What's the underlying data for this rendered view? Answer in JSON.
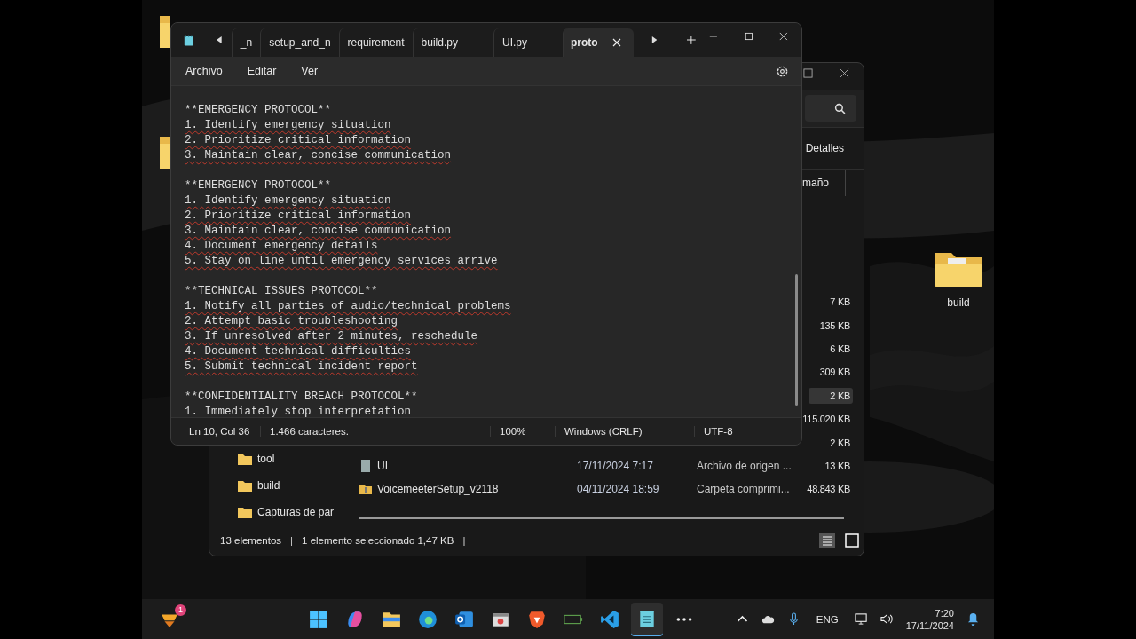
{
  "notepad": {
    "tabs": [
      {
        "label": "_n",
        "selected": false
      },
      {
        "label": "setup_and_n",
        "selected": false
      },
      {
        "label": "requirement",
        "selected": false
      },
      {
        "label": "build.py",
        "selected": false
      },
      {
        "label": "UI.py",
        "selected": false
      },
      {
        "label": "proto",
        "selected": true
      }
    ],
    "menu": [
      "Archivo",
      "Editar",
      "Ver"
    ],
    "lines": [
      {
        "kind": "header",
        "text": "**EMERGENCY PROTOCOL**"
      },
      {
        "kind": "item",
        "text": "1. Identify emergency situation"
      },
      {
        "kind": "item",
        "text": "2. Prioritize critical information"
      },
      {
        "kind": "item",
        "text": "3. Maintain clear, concise communication"
      },
      {
        "kind": "blank"
      },
      {
        "kind": "header",
        "text": "**EMERGENCY PROTOCOL**"
      },
      {
        "kind": "item",
        "text": "1. Identify emergency situation"
      },
      {
        "kind": "item",
        "text": "2. Prioritize critical information"
      },
      {
        "kind": "item",
        "text": "3. Maintain clear, concise communication"
      },
      {
        "kind": "item",
        "text": "4. Document emergency details"
      },
      {
        "kind": "item",
        "text": "5. Stay on line until emergency services arrive"
      },
      {
        "kind": "blank"
      },
      {
        "kind": "header",
        "text": "**TECHNICAL ISSUES PROTOCOL**"
      },
      {
        "kind": "item",
        "text": "1. Notify all parties of audio/technical problems"
      },
      {
        "kind": "item",
        "text": "2. Attempt basic troubleshooting"
      },
      {
        "kind": "item",
        "text": "3. If unresolved after 2 minutes, reschedule"
      },
      {
        "kind": "item",
        "text": "4. Document technical difficulties"
      },
      {
        "kind": "item",
        "text": "5. Submit technical incident report"
      },
      {
        "kind": "blank"
      },
      {
        "kind": "header",
        "text": "**CONFIDENTIALITY BREACH PROTOCOL**"
      },
      {
        "kind": "item",
        "text": "1. Immediately stop interpretation"
      }
    ],
    "status": {
      "position": "Ln 10, Col 36",
      "chars": "1.466 caracteres.",
      "zoom": "100%",
      "line_ending": "Windows (CRLF)",
      "encoding": "UTF-8"
    }
  },
  "explorer": {
    "view_button": "Detalles",
    "size_header": "maño",
    "nav": [
      "tool",
      "build",
      "Capturas de par"
    ],
    "files": [
      {
        "size": "7 KB",
        "selected": false
      },
      {
        "size": "135 KB",
        "selected": false
      },
      {
        "size": "6 KB",
        "selected": false
      },
      {
        "size": "309 KB",
        "selected": false
      },
      {
        "size": "2 KB",
        "selected": true
      },
      {
        "size": "115.020 KB",
        "selected": false
      },
      {
        "size": "2 KB",
        "selected": false
      },
      {
        "name": "UI",
        "date": "17/11/2024 7:17",
        "type": "Archivo de origen ...",
        "size": "13 KB",
        "selected": false
      },
      {
        "name": "VoicemeeterSetup_v2118",
        "date": "04/11/2024 18:59",
        "type": "Carpeta comprimi...",
        "size": "48.843 KB",
        "selected": false
      }
    ],
    "status": [
      {
        "kind": "text",
        "text": "13 elementos"
      },
      {
        "kind": "separator",
        "text": "|"
      },
      {
        "kind": "text",
        "text": "1 elemento seleccionado  1,47 KB"
      },
      {
        "kind": "separator",
        "text": "|"
      }
    ]
  },
  "desktop_icon": "build",
  "taskbar": {
    "badge": "1",
    "language": "ENG",
    "time": "7:20",
    "date": "17/11/2024"
  }
}
